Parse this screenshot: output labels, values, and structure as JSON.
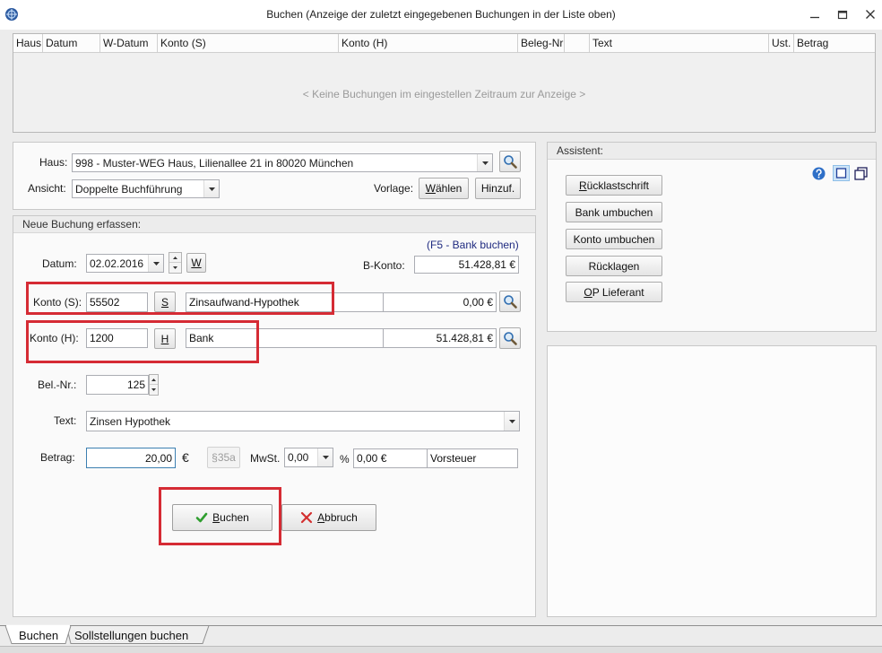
{
  "window": {
    "title": "Buchen (Anzeige der zuletzt eingegebenen Buchungen in der Liste oben)",
    "icon": "app-globe-icon",
    "controls": [
      "minimize-icon",
      "restore-icon",
      "close-icon"
    ]
  },
  "bookings_table": {
    "columns": [
      "Haus",
      "Datum",
      "W-Datum",
      "Konto (S)",
      "Konto (H)",
      "Beleg-Nr",
      "",
      "Text",
      "Ust.",
      "Betrag"
    ],
    "rows": [],
    "empty_message": "< Keine Buchungen im eingestellen Zeitraum zur Anzeige >"
  },
  "filters": {
    "haus": {
      "label": "Haus:",
      "value": "998 - Muster-WEG Haus, Lilienallee 21 in 80020 München"
    },
    "ansicht": {
      "label": "Ansicht:",
      "value": "Doppelte Buchführung"
    },
    "vorlage": {
      "label": "Vorlage:",
      "choose_button": "Wählen",
      "add_button": "Hinzuf."
    }
  },
  "entry": {
    "section_title": "Neue Buchung erfassen:",
    "bank_shortcut_hint": "(F5 - Bank buchen)",
    "datum": {
      "label": "Datum:",
      "value": "02.02.2016",
      "w_button": "W"
    },
    "b_konto": {
      "label": "B-Konto:",
      "value": "51.428,81 €"
    },
    "konto_soll": {
      "label": "Konto (S):",
      "number": "55502",
      "side_button": "S",
      "name": "Zinsaufwand-Hypothek",
      "balance": "0,00 €"
    },
    "konto_haben": {
      "label": "Konto (H):",
      "number": "1200",
      "side_button": "H",
      "name": "Bank",
      "balance": "51.428,81 €"
    },
    "beleg_nr": {
      "label": "Bel.-Nr.:",
      "value": "125"
    },
    "text": {
      "label": "Text:",
      "value": "Zinsen Hypothek"
    },
    "betrag": {
      "label": "Betrag:",
      "value": "20,00",
      "currency": "€",
      "par35a_button": "§35a",
      "par35a_enabled": false,
      "mwst_label": "MwSt.",
      "mwst_value": "0,00",
      "percent_sign": "%",
      "vorsteuer_amount": "0,00 €",
      "vorsteuer_label": "Vorsteuer"
    },
    "actions": {
      "submit": "Buchen",
      "cancel": "Abbruch"
    }
  },
  "assistant": {
    "title": "Assistent:",
    "buttons": [
      "Rücklastschrift",
      "Bank umbuchen",
      "Konto umbuchen",
      "Rücklagen",
      "OP Lieferant"
    ],
    "view_icons": [
      "help-icon",
      "single-view-icon",
      "double-view-icon"
    ],
    "selected_view": "single-view-icon"
  },
  "tabs": [
    {
      "label": "Buchen",
      "active": true
    },
    {
      "label": "Sollstellungen buchen",
      "active": false
    }
  ],
  "colors": {
    "highlight": "#d52b34",
    "focus_border": "#3c7fb1",
    "hint_text": "#1f2a80",
    "confirm": "#2f9e2f",
    "cancel": "#d32f2f",
    "help": "#2e6fc7"
  }
}
